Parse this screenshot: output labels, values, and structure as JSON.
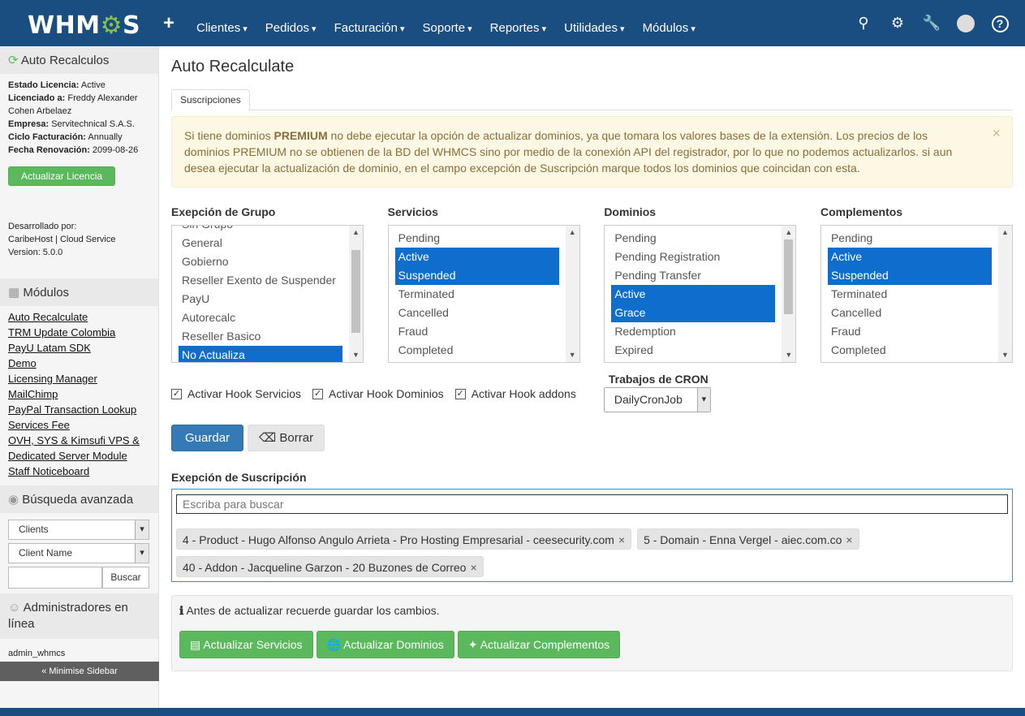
{
  "header": {
    "logo": "WHMCS",
    "add": "+",
    "nav": [
      "Clientes",
      "Pedidos",
      "Facturación",
      "Soporte",
      "Reportes",
      "Utilidades",
      "Módulos"
    ],
    "icons": [
      "search-icon",
      "gears-icon",
      "wrench-icon",
      "user-avatar-icon",
      "help-icon"
    ]
  },
  "sidebar": {
    "license": {
      "title": "Auto Recalculos",
      "estado_label": "Estado Licencia:",
      "estado": "Active",
      "licenciado_label": "Licenciado a:",
      "licenciado": "Freddy Alexander Cohen Arbelaez",
      "empresa_label": "Empresa:",
      "empresa": "Servitechnical S.A.S.",
      "ciclo_label": "Ciclo Facturación:",
      "ciclo": "Annually",
      "renovacion_label": "Fecha Renovación:",
      "renovacion": "2099-08-26",
      "button": "Actualizar Licencia",
      "dev_label": "Desarrollado por:",
      "dev": "CaribeHost | Cloud Service",
      "version": "Version: 5.0.0"
    },
    "modules": {
      "title": "Módulos",
      "items": [
        "Auto Recalculate",
        "TRM Update Colombia",
        "PayU Latam SDK",
        "Demo",
        "Licensing Manager",
        "MailChimp",
        "PayPal Transaction Lookup",
        "Services Fee",
        "OVH, SYS & Kimsufi VPS & Dedicated Server Module",
        "Staff Noticeboard"
      ]
    },
    "search": {
      "title": "Búsqueda avanzada",
      "type": "Clients",
      "field": "Client Name",
      "button": "Buscar"
    },
    "admins": {
      "title": "Administradores en línea",
      "user": "admin_whmcs"
    },
    "minimise": "« Minimise Sidebar"
  },
  "main": {
    "title": "Auto Recalculate",
    "tab": "Suscripciones",
    "alert": {
      "pre": "Si tiene dominios ",
      "bold": "PREMIUM",
      "post": " no debe ejecutar la opción de actualizar dominios, ya que tomara los valores bases de la extensión. Los precios de los dominios PREMIUM no se obtienen de la BD del WHMCS sino por medio de la conexión API del registrador, por lo que no podemos actualizarlos. si aun desea ejecutar la actualización de dominio, en el campo excepción de Suscripción marque todos los dominios que coincidan con esta.",
      "close": "×"
    },
    "lists": [
      {
        "title": "Exepción de Grupo",
        "items": [
          "Sin Grupo",
          "General",
          "Gobierno",
          "Reseller Exento de Suspender",
          "PayU",
          "Autorecalc",
          "Reseller Basico",
          "No Actualiza"
        ],
        "selected": [
          7
        ]
      },
      {
        "title": "Servicios",
        "items": [
          "Pending",
          "Active",
          "Suspended",
          "Terminated",
          "Cancelled",
          "Fraud",
          "Completed"
        ],
        "selected": [
          1,
          2
        ]
      },
      {
        "title": "Dominios",
        "items": [
          "Pending",
          "Pending Registration",
          "Pending Transfer",
          "Active",
          "Grace",
          "Redemption",
          "Expired"
        ],
        "selected": [
          3,
          4
        ]
      },
      {
        "title": "Complementos",
        "items": [
          "Pending",
          "Active",
          "Suspended",
          "Terminated",
          "Cancelled",
          "Fraud",
          "Completed"
        ],
        "selected": [
          1,
          2
        ]
      }
    ],
    "hooks": [
      {
        "label": "Activar Hook Servicios",
        "checked": true
      },
      {
        "label": "Activar Hook Dominios",
        "checked": true
      },
      {
        "label": "Activar Hook addons",
        "checked": true
      }
    ],
    "cron": {
      "title": "Trabajos de CRON",
      "value": "DailyCronJob"
    },
    "save": "Guardar",
    "clear": "Borrar",
    "subscription": {
      "title": "Exepción de Suscripción",
      "placeholder": "Escriba para buscar",
      "tags": [
        "4 - Product - Hugo Alfonso Angulo Arrieta - Pro Hosting Empresarial - ceesecurity.com",
        "5 - Domain - Enna Vergel - aiec.com.co",
        "40 - Addon - Jacqueline Garzon - 20 Buzones de Correo"
      ]
    },
    "note": "Antes de actualizar recuerde guardar los cambios.",
    "actions": [
      "Actualizar Servicios",
      "Actualizar Dominios",
      "Actualizar Complementos"
    ]
  }
}
